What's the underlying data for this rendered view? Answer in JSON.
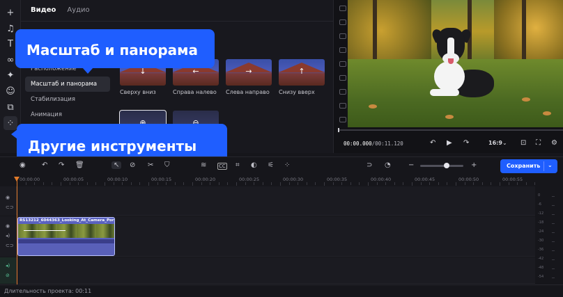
{
  "panel": {
    "tabs": [
      {
        "label": "Видео",
        "active": true
      },
      {
        "label": "Аудио",
        "active": false
      }
    ],
    "menu": [
      {
        "label": "Расположение",
        "active": false
      },
      {
        "label": "Масштаб и панорама",
        "active": true
      },
      {
        "label": "Стабилизация",
        "active": false
      },
      {
        "label": "Анимация",
        "active": false
      }
    ],
    "presets": [
      {
        "label": "Сверху вниз",
        "arrow": "↓"
      },
      {
        "label": "Справа налево",
        "arrow": "←"
      },
      {
        "label": "Слева направо",
        "arrow": "→"
      },
      {
        "label": "Снизу вверх",
        "arrow": "↑"
      }
    ]
  },
  "callouts": {
    "zoom_pan": "Масштаб и панорама",
    "other_tools": "Другие инструменты"
  },
  "preview": {
    "time_current": "00:00.000",
    "time_total": "/00:11.120",
    "aspect": "16:9"
  },
  "toolbar": {
    "save_label": "Сохранить",
    "cc_label": "CC"
  },
  "ruler": {
    "ticks": [
      "00:00:00",
      "00:00:05",
      "00:00:10",
      "00:00:15",
      "00:00:20",
      "00:00:25",
      "00:00:30",
      "00:00:35",
      "00:00:40",
      "00:00:45",
      "00:00:50",
      "00:00:55"
    ]
  },
  "timeline": {
    "clip_name": "RS13212_6044363_Looking_At_Camera_Por"
  },
  "meter": {
    "labels": [
      "0",
      "-6",
      "-12",
      "-18",
      "-24",
      "-30",
      "-36",
      "-42",
      "-48",
      "-54"
    ]
  },
  "footer": {
    "duration": "Длительность проекта: 00:11"
  }
}
